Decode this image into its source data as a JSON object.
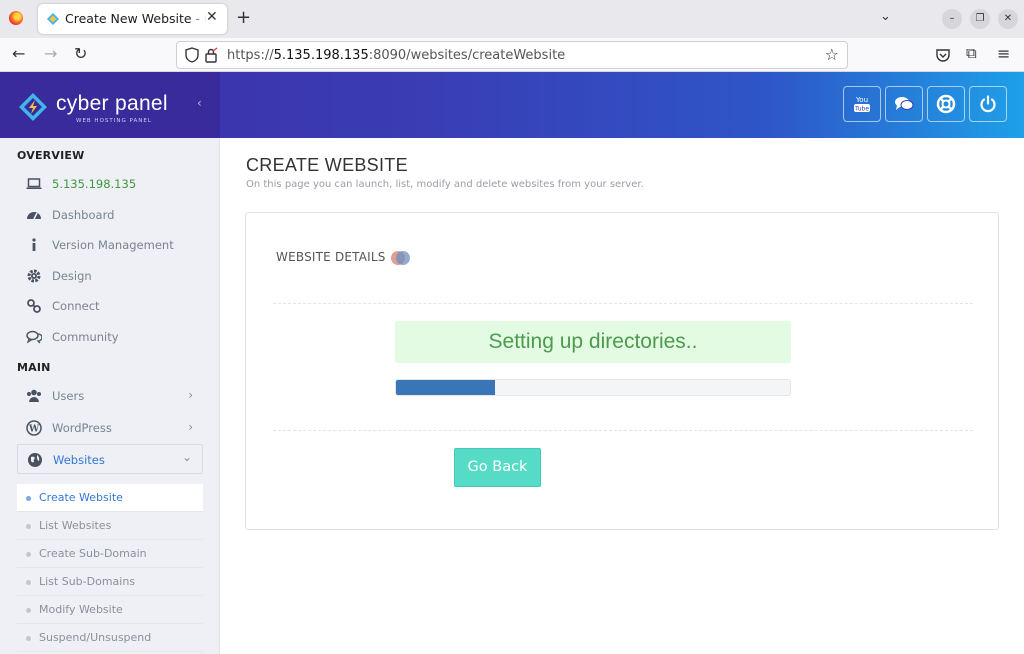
{
  "browser": {
    "tab_title": "Create New Website - CyberPanel",
    "url_prefix": "https://",
    "url_host": "5.135.198.135",
    "url_rest": ":8090/websites/createWebsite"
  },
  "brand": {
    "name": "cyber panel",
    "tagline": "WEB HOSTING PANEL"
  },
  "header_buttons": [
    {
      "icon": "youtube-icon"
    },
    {
      "icon": "chat-icon"
    },
    {
      "icon": "lifebuoy-icon"
    },
    {
      "icon": "power-icon"
    }
  ],
  "sidebar": {
    "overview_label": "OVERVIEW",
    "main_label": "MAIN",
    "overview_items": [
      {
        "label": "5.135.198.135",
        "icon": "laptop-icon"
      },
      {
        "label": "Dashboard",
        "icon": "dashboard-icon"
      },
      {
        "label": "Version Management",
        "icon": "info-icon"
      },
      {
        "label": "Design",
        "icon": "gear-icon"
      },
      {
        "label": "Connect",
        "icon": "link-icon"
      },
      {
        "label": "Community",
        "icon": "comments-icon"
      }
    ],
    "main_items": [
      {
        "label": "Users",
        "icon": "users-icon"
      },
      {
        "label": "WordPress",
        "icon": "wordpress-icon"
      },
      {
        "label": "Websites",
        "icon": "globe-icon"
      }
    ],
    "websites_submenu": [
      "Create Website",
      "List Websites",
      "Create Sub-Domain",
      "List Sub-Domains",
      "Modify Website",
      "Suspend/Unsuspend"
    ]
  },
  "main": {
    "title": "CREATE WEBSITE",
    "description": "On this page you can launch, list, modify and delete websites from your server.",
    "panel_heading": "WEBSITE DETAILS",
    "status_text": "Setting up directories..",
    "progress_percent": 25,
    "go_back_label": "Go Back"
  },
  "colors": {
    "header_start": "#3e2ea6",
    "header_end": "#1ea0e8",
    "status_bg": "#e2fbe2",
    "status_text": "#4e9a4e",
    "progress_fill": "#3a75b8",
    "go_back_bg": "#56dbc6",
    "active_link": "#3478d4"
  }
}
